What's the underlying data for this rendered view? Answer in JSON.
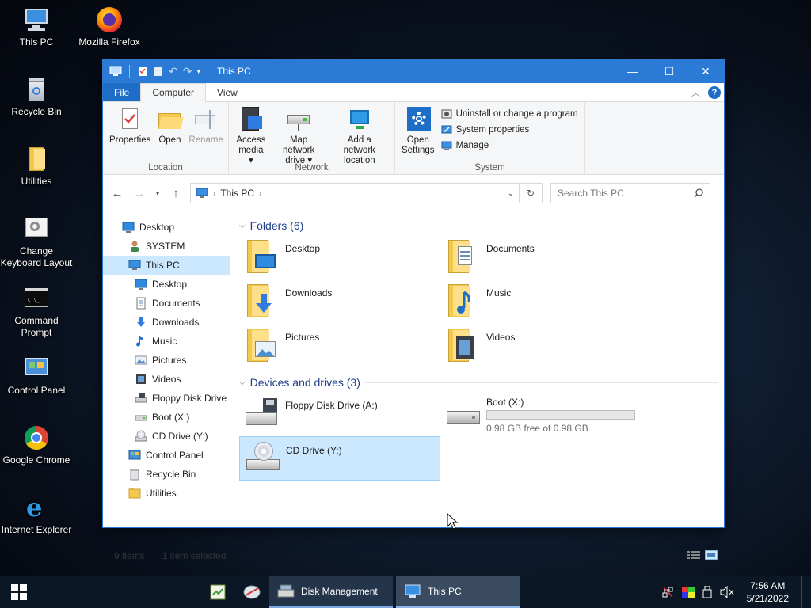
{
  "desktop_icons": [
    {
      "label": "This PC",
      "icon": "computer-icon"
    },
    {
      "label": "Mozilla Firefox",
      "icon": "firefox-icon"
    },
    {
      "label": "Recycle Bin",
      "icon": "recycle-bin-icon"
    },
    {
      "label": "Utilities",
      "icon": "folder-icon"
    },
    {
      "label": "Change Keyboard Layout",
      "icon": "keyboard-settings-icon"
    },
    {
      "label": "Command Prompt",
      "icon": "command-prompt-icon"
    },
    {
      "label": "Control Panel",
      "icon": "control-panel-icon"
    },
    {
      "label": "Google Chrome",
      "icon": "chrome-icon"
    },
    {
      "label": "Internet Explorer",
      "icon": "internet-explorer-icon"
    }
  ],
  "window": {
    "title": "This PC",
    "tabs": {
      "file": "File",
      "computer": "Computer",
      "view": "View"
    },
    "ribbon": {
      "location": {
        "label": "Location",
        "properties": "Properties",
        "open": "Open",
        "rename": "Rename"
      },
      "network": {
        "label": "Network",
        "access_media_1": "Access",
        "access_media_2": "media",
        "map_drive_1": "Map network",
        "map_drive_2": "drive",
        "add_location_1": "Add a network",
        "add_location_2": "location"
      },
      "system": {
        "label": "System",
        "open_settings_1": "Open",
        "open_settings_2": "Settings",
        "uninstall": "Uninstall or change a program",
        "system_properties": "System properties",
        "manage": "Manage"
      }
    },
    "address": {
      "crumb": "This PC",
      "search_placeholder": "Search This PC"
    },
    "nav": [
      {
        "label": "Desktop",
        "indent": 0,
        "icon": "desktop-icon"
      },
      {
        "label": "SYSTEM",
        "indent": 1,
        "icon": "user-icon"
      },
      {
        "label": "This PC",
        "indent": 1,
        "icon": "computer-icon",
        "selected": true
      },
      {
        "label": "Desktop",
        "indent": 2,
        "icon": "desktop-icon"
      },
      {
        "label": "Documents",
        "indent": 2,
        "icon": "documents-icon"
      },
      {
        "label": "Downloads",
        "indent": 2,
        "icon": "downloads-icon"
      },
      {
        "label": "Music",
        "indent": 2,
        "icon": "music-icon"
      },
      {
        "label": "Pictures",
        "indent": 2,
        "icon": "pictures-icon"
      },
      {
        "label": "Videos",
        "indent": 2,
        "icon": "videos-icon"
      },
      {
        "label": "Floppy Disk Drive",
        "indent": 2,
        "icon": "floppy-icon"
      },
      {
        "label": "Boot (X:)",
        "indent": 2,
        "icon": "drive-icon"
      },
      {
        "label": "CD Drive (Y:)",
        "indent": 2,
        "icon": "cd-drive-icon"
      },
      {
        "label": "Control Panel",
        "indent": 1,
        "icon": "control-panel-icon"
      },
      {
        "label": "Recycle Bin",
        "indent": 1,
        "icon": "recycle-bin-icon"
      },
      {
        "label": "Utilities",
        "indent": 1,
        "icon": "folder-icon"
      }
    ],
    "folders_header": "Folders (6)",
    "folders": [
      {
        "label": "Desktop",
        "icon": "desktop-folder-icon"
      },
      {
        "label": "Documents",
        "icon": "documents-folder-icon"
      },
      {
        "label": "Downloads",
        "icon": "downloads-folder-icon"
      },
      {
        "label": "Music",
        "icon": "music-folder-icon"
      },
      {
        "label": "Pictures",
        "icon": "pictures-folder-icon"
      },
      {
        "label": "Videos",
        "icon": "videos-folder-icon"
      }
    ],
    "drives_header": "Devices and drives (3)",
    "drives": [
      {
        "label": "Floppy Disk Drive (A:)",
        "icon": "floppy-drive-icon"
      },
      {
        "label": "Boot (X:)",
        "icon": "hard-drive-icon",
        "free_text": "0.98 GB free of 0.98 GB",
        "used_fraction": 0.0
      },
      {
        "label": "CD Drive (Y:)",
        "icon": "cd-drive-icon",
        "selected": true
      }
    ],
    "status": {
      "items": "9 items",
      "selected": "1 item selected"
    }
  },
  "taskbar": {
    "apps": [
      {
        "label": "Disk Management",
        "icon": "disk-management-icon"
      },
      {
        "label": "This PC",
        "icon": "computer-icon"
      }
    ],
    "clock_time": "7:56 AM",
    "clock_date": "5/21/2022"
  },
  "colors": {
    "accent": "#2b7bd6",
    "selection": "#cce8ff",
    "folder": "#f2c94c"
  }
}
